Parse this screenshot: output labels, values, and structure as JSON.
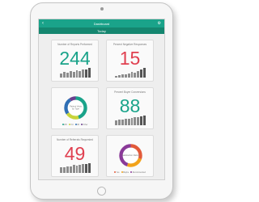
{
  "app": {
    "title": "Dashboard",
    "tab": "Today"
  },
  "cards": [
    {
      "title": "Number of Reports Performed",
      "value": "244",
      "color": "#1aa38a",
      "bars": [
        0.45,
        0.55,
        0.5,
        0.65,
        0.6,
        0.75,
        0.7,
        0.85,
        0.8,
        1.0
      ]
    },
    {
      "title": "Percent Negative Responses",
      "value": "15",
      "color": "#e04050",
      "bars": [
        0.2,
        0.25,
        0.3,
        0.35,
        0.45,
        0.55,
        0.5,
        0.7,
        0.85,
        1.0
      ]
    },
    {
      "title": "",
      "donut": {
        "center_text": "Patient Visits by Type",
        "segments": [
          {
            "label": "WC",
            "color": "#1aa38a",
            "value": 0.45
          },
          {
            "label": "FU",
            "color": "#c8d43a",
            "value": 0.2
          },
          {
            "label": "IM",
            "color": "#2f6fb5",
            "value": 0.25
          },
          {
            "label": "Other",
            "color": "#6b3f8f",
            "value": 0.1
          }
        ]
      }
    },
    {
      "title": "Percent Buyer Conversions",
      "value": "88",
      "color": "#1aa38a",
      "bars": [
        0.5,
        0.6,
        0.55,
        0.65,
        0.7,
        0.75,
        0.8,
        0.85,
        0.9,
        1.0
      ]
    },
    {
      "title": "Number of Referrals Requested",
      "value": "49",
      "color": "#e04050",
      "bars": [
        0.55,
        0.6,
        0.7,
        0.65,
        0.8,
        0.75,
        0.85,
        0.9,
        0.95,
        1.0
      ]
    },
    {
      "title": "",
      "donut": {
        "center_text": "Satisfaction Rating",
        "segments": [
          {
            "label": "Yes",
            "color": "#e25a3a",
            "value": 0.3
          },
          {
            "label": "Maybe",
            "color": "#f2a31b",
            "value": 0.25
          },
          {
            "label": "Recommended",
            "color": "#8a3a98",
            "value": 0.45
          }
        ]
      }
    }
  ]
}
